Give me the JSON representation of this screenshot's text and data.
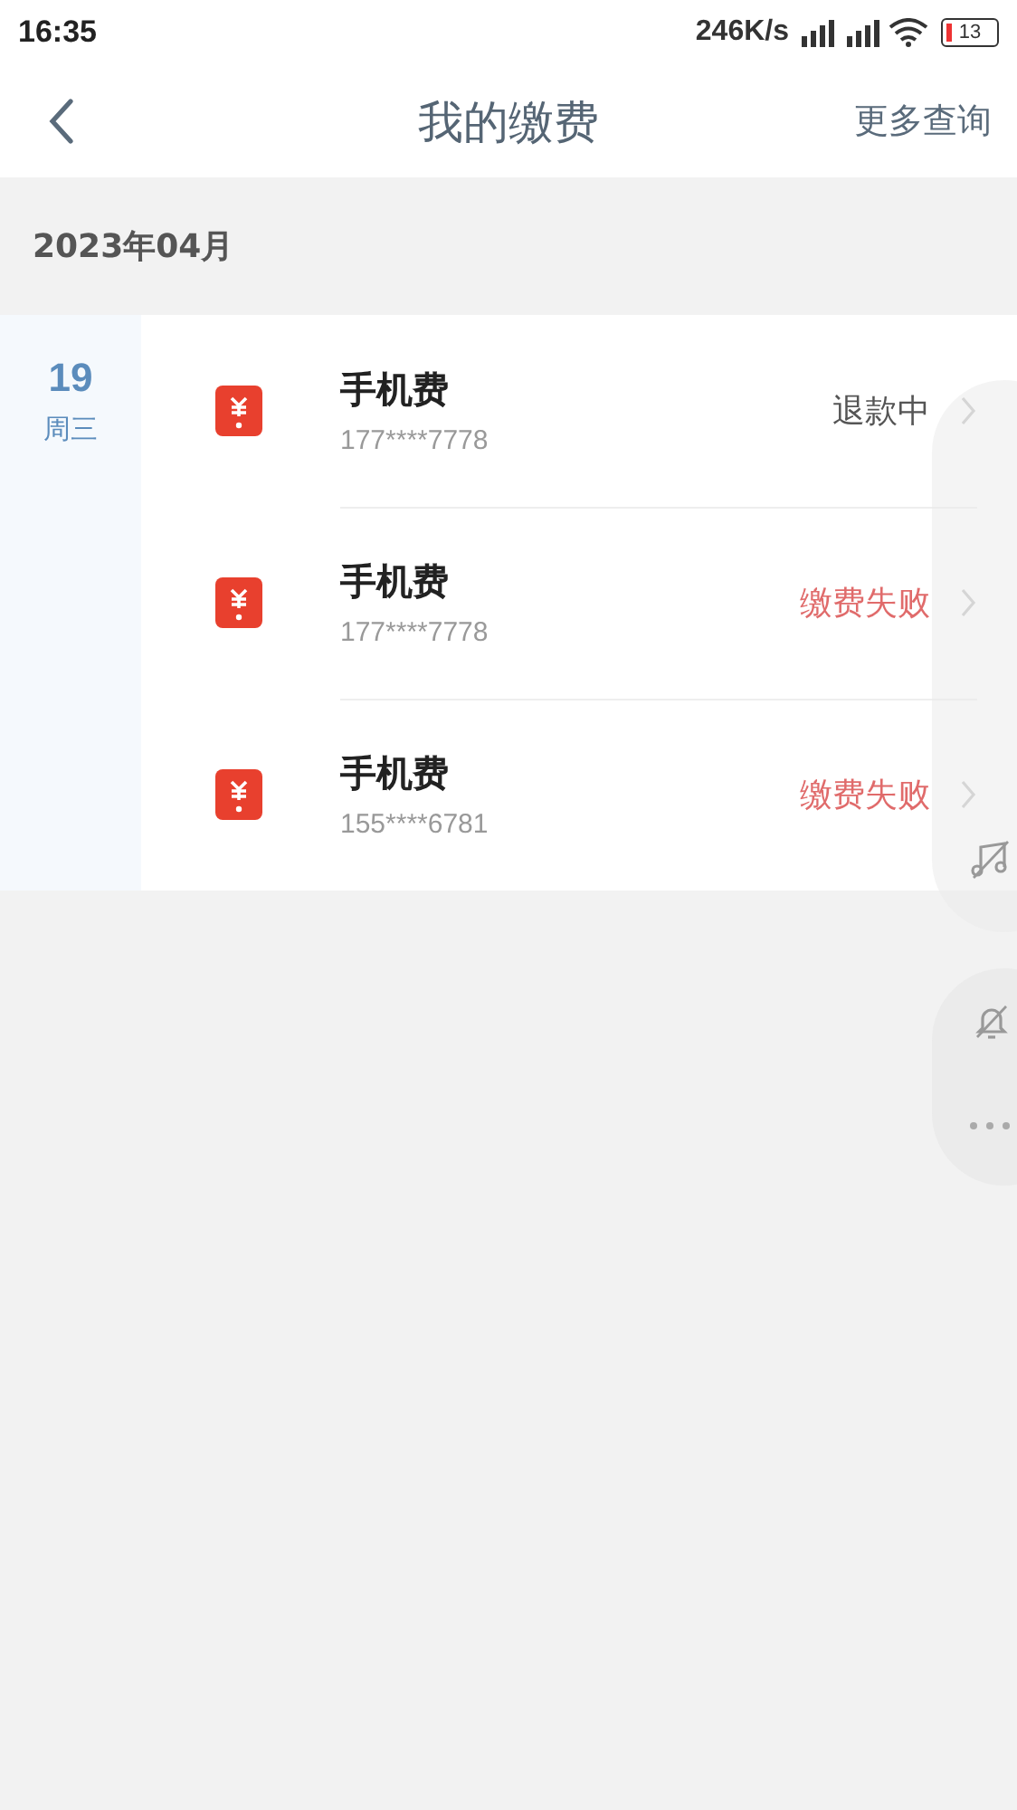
{
  "status_bar": {
    "time": "16:35",
    "speed": "246K/s",
    "battery": "13"
  },
  "nav": {
    "title": "我的缴费",
    "action": "更多查询"
  },
  "month": "2023年04月",
  "groups": [
    {
      "day": "19",
      "weekday": "周三",
      "items": [
        {
          "name": "手机费",
          "number": "177****7778",
          "status": {
            "text": "退款中",
            "kind": "refunding"
          }
        },
        {
          "name": "手机费",
          "number": "177****7778",
          "status": {
            "text": "缴费失败",
            "kind": "failed"
          }
        },
        {
          "name": "手机费",
          "number": "155****6781",
          "status": {
            "text": "缴费失败",
            "kind": "failed"
          }
        }
      ]
    }
  ]
}
